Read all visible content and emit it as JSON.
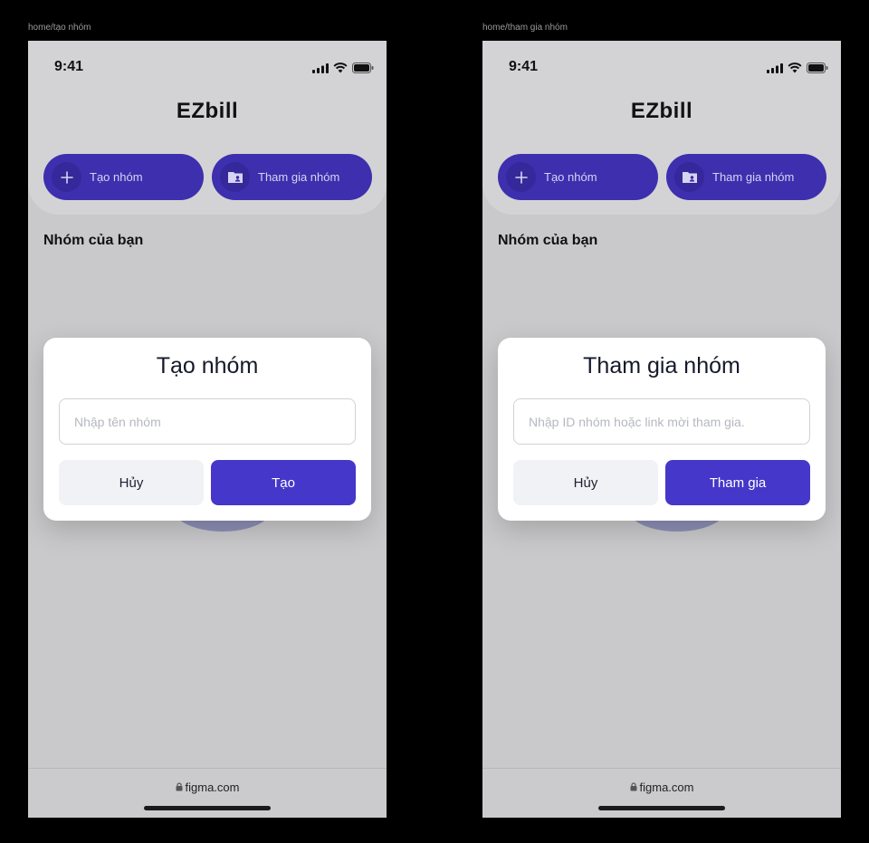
{
  "frames": [
    {
      "label": "home/tạo nhóm",
      "status_time": "9:41",
      "app_title": "EZbill",
      "buttons": {
        "create": "Tạo nhóm",
        "join": "Tham gia nhóm"
      },
      "section_title": "Nhóm của bạn",
      "modal": {
        "title": "Tạo nhóm",
        "input_placeholder": "Nhập tên nhóm",
        "input_value": "",
        "cancel_label": "Hủy",
        "confirm_label": "Tạo"
      },
      "url": "figma.com"
    },
    {
      "label": "home/tham gia nhóm",
      "status_time": "9:41",
      "app_title": "EZbill",
      "buttons": {
        "create": "Tạo nhóm",
        "join": "Tham gia nhóm"
      },
      "section_title": "Nhóm của bạn",
      "modal": {
        "title": "Tham gia nhóm",
        "input_placeholder": "Nhập ID nhóm hoặc link mời tham gia.",
        "input_value": "",
        "cancel_label": "Hủy",
        "confirm_label": "Tham gia"
      },
      "url": "figma.com"
    }
  ],
  "icons": {
    "create": "plus-icon",
    "join": "folder-user-icon",
    "signal": "cellular-signal-icon",
    "wifi": "wifi-icon",
    "battery": "battery-icon",
    "lock": "lock-icon"
  },
  "colors": {
    "primary": "#4537c9",
    "pill": "#3d2fae",
    "overlay_background": "#c9c9cb",
    "modal_background": "#ffffff",
    "cancel_background": "#f1f2f5"
  }
}
